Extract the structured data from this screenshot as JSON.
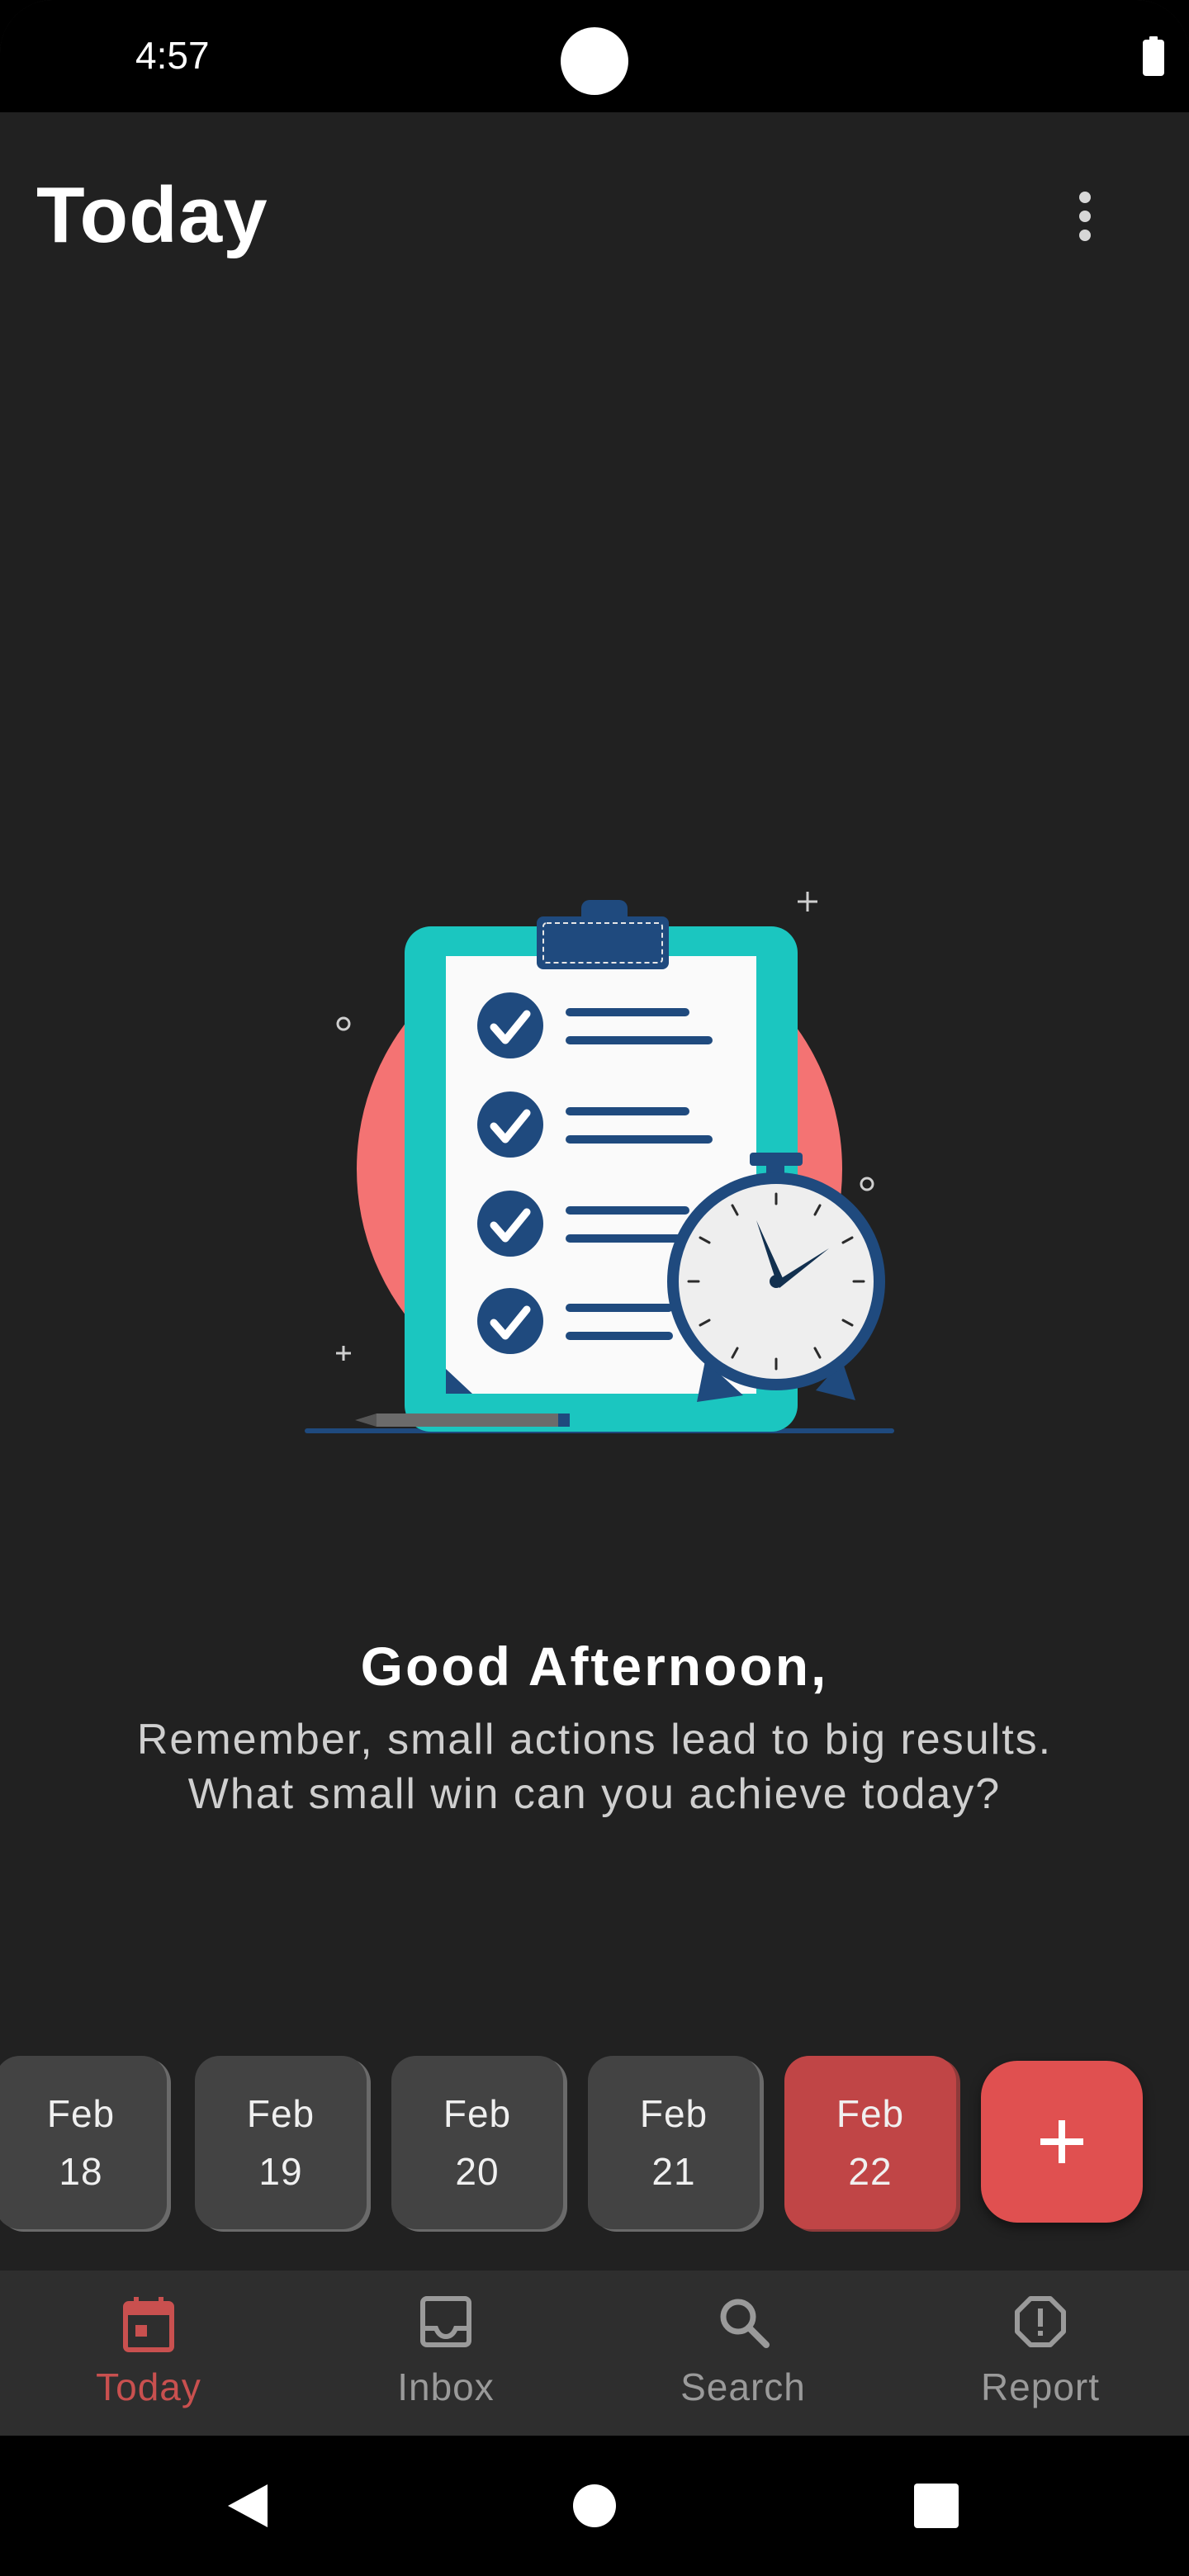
{
  "status_bar": {
    "time": "4:57",
    "icons": [
      "camera-cutout",
      "battery-icon"
    ]
  },
  "header": {
    "title": "Today",
    "menu_icon": "more-vertical-icon"
  },
  "illustration": {
    "description_icon": "clipboard-checklist-stopwatch-illustration"
  },
  "greeting": {
    "title": "Good Afternoon,",
    "message_line1": "Remember, small actions lead to big results.",
    "message_line2": "What small win can you achieve today?"
  },
  "date_strip": {
    "days": [
      {
        "month": "Feb",
        "day": "18",
        "selected": false
      },
      {
        "month": "Feb",
        "day": "19",
        "selected": false
      },
      {
        "month": "Feb",
        "day": "20",
        "selected": false
      },
      {
        "month": "Feb",
        "day": "21",
        "selected": false
      },
      {
        "month": "Feb",
        "day": "22",
        "selected": true
      }
    ],
    "add_icon": "plus-icon"
  },
  "bottom_nav": {
    "items": [
      {
        "label": "Today",
        "icon": "calendar-icon",
        "active": true
      },
      {
        "label": "Inbox",
        "icon": "inbox-icon",
        "active": false
      },
      {
        "label": "Search",
        "icon": "search-icon",
        "active": false
      },
      {
        "label": "Report",
        "icon": "report-icon",
        "active": false
      }
    ]
  },
  "system_nav": {
    "icons": [
      "back-icon",
      "home-icon",
      "recents-icon"
    ]
  },
  "colors": {
    "background": "#212121",
    "accent": "#e05050",
    "selected_chip": "#c04546",
    "chip": "#434343",
    "nav_active": "#c9504f",
    "nav_inactive": "#9a9a9a"
  }
}
